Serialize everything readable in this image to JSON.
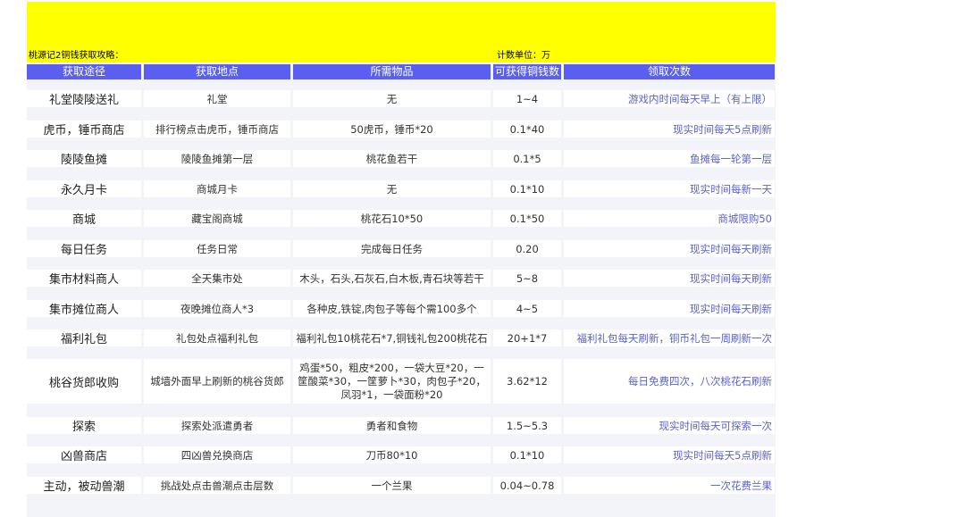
{
  "banner": {
    "title": "桃源记2铜钱获取攻略：",
    "unit": "计数单位：万",
    "color": "#ffff00"
  },
  "table": {
    "header_color": "#5a5ff0",
    "count_text_color": "#5a62cc",
    "headers": [
      "获取途径",
      "获取地点",
      "所需物品",
      "可获得铜钱数",
      "领取次数"
    ],
    "rows": [
      [
        "礼堂陵陵送礼",
        "礼堂",
        "无",
        "1~4",
        "游戏内时间每天早上（有上限）"
      ],
      [
        "虎币，锤币商店",
        "排行榜点击虎币，锤币商店",
        "50虎币，锤币*20",
        "0.1*40",
        "现实时间每天5点刷新"
      ],
      [
        "陵陵鱼摊",
        "陵陵鱼摊第一层",
        "桃花鱼若干",
        "0.1*5",
        "鱼摊每一轮第一层"
      ],
      [
        "永久月卡",
        "商城月卡",
        "无",
        "0.1*10",
        "现实时间每新一天"
      ],
      [
        "商城",
        "藏宝阁商城",
        "桃花石10*50",
        "0.1*50",
        "商城限购50"
      ],
      [
        "每日任务",
        "任务日常",
        "完成每日任务",
        "0.20",
        "现实时间每天刷新"
      ],
      [
        "集市材料商人",
        "全天集市处",
        "木头，石头,石灰石,白木板,青石块等若干",
        "5~8",
        "现实时间每天刷新"
      ],
      [
        "集市摊位商人",
        "夜晚摊位商人*3",
        "各种皮,铁锭,肉包子等每个需100多个",
        "4~5",
        "现实时间每天刷新"
      ],
      [
        "福利礼包",
        "礼包处点福利礼包",
        "福利礼包10桃花石*7,铜钱礼包200桃花石",
        "20+1*7",
        "福利礼包每天刷新，铜币礼包一周刷新一次"
      ],
      [
        "桃谷货郎收购",
        "城墙外面早上刷新的桃谷货郎",
        "鸡蛋*50，粗皮*200，一袋大豆*20，一筐酸菜*30，一筐萝卜*30，肉包子*20，凤羽*1，一袋面粉*20",
        "3.62*12",
        "每日免费四次，八次桃花石刷新"
      ],
      [
        "探索",
        "探索处派遣勇者",
        "勇者和食物",
        "1.5~5.3",
        "现实时间每天可探索一次"
      ],
      [
        "凶兽商店",
        "四凶兽兑换商店",
        "刀币80*10",
        "0.1*10",
        "现实时间每天5点刷新"
      ],
      [
        "主动，被动兽潮",
        "挑战处点击兽潮点击层数",
        "一个兰果",
        "0.04~0.78",
        "一次花费兰果"
      ]
    ]
  }
}
